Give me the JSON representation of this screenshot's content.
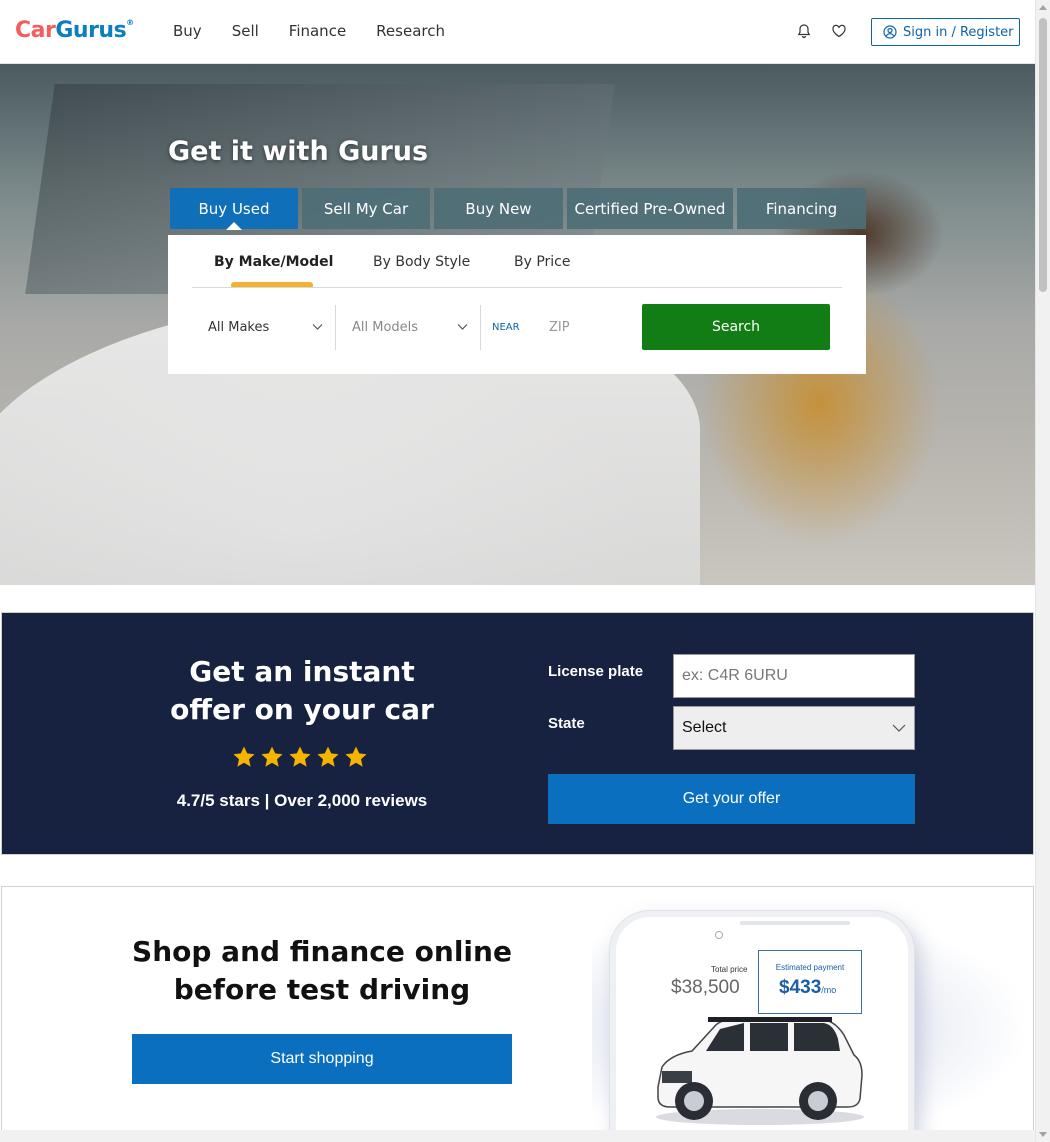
{
  "header": {
    "logo": {
      "car": "Car",
      "gurus": "Gurus",
      "reg": "®"
    },
    "nav": [
      "Buy",
      "Sell",
      "Finance",
      "Research"
    ],
    "signin": "Sign in / Register"
  },
  "hero": {
    "title": "Get it with Gurus",
    "tabs": [
      "Buy Used",
      "Sell My Car",
      "Buy New",
      "Certified Pre-Owned",
      "Financing"
    ],
    "active_tab": "Buy Used",
    "subtabs": [
      "By Make/Model",
      "By Body Style",
      "By Price"
    ],
    "active_subtab": "By Make/Model",
    "makes": "All Makes",
    "models": "All Models",
    "near": "NEAR",
    "zip_placeholder": "ZIP",
    "search": "Search"
  },
  "offer": {
    "title": "Get an instant offer on your car",
    "rating": 5,
    "reviews": "4.7/5 stars | Over 2,000 reviews",
    "plate_label": "License plate",
    "plate_placeholder": "ex: C4R 6URU",
    "state_label": "State",
    "state_value": "Select",
    "button": "Get your offer"
  },
  "shop": {
    "title": "Shop and finance online before test driving",
    "button": "Start shopping",
    "phone": {
      "total_label": "Total price",
      "total_value": "$38,500",
      "est_label": "Estimated payment",
      "est_value": "$433",
      "est_unit": "/mo"
    }
  },
  "colors": {
    "brand_blue": "#0a6fbf",
    "logo_red": "#f45d5d",
    "search_green": "#137d15",
    "offer_bg": "#172240",
    "star": "#f4b400"
  }
}
